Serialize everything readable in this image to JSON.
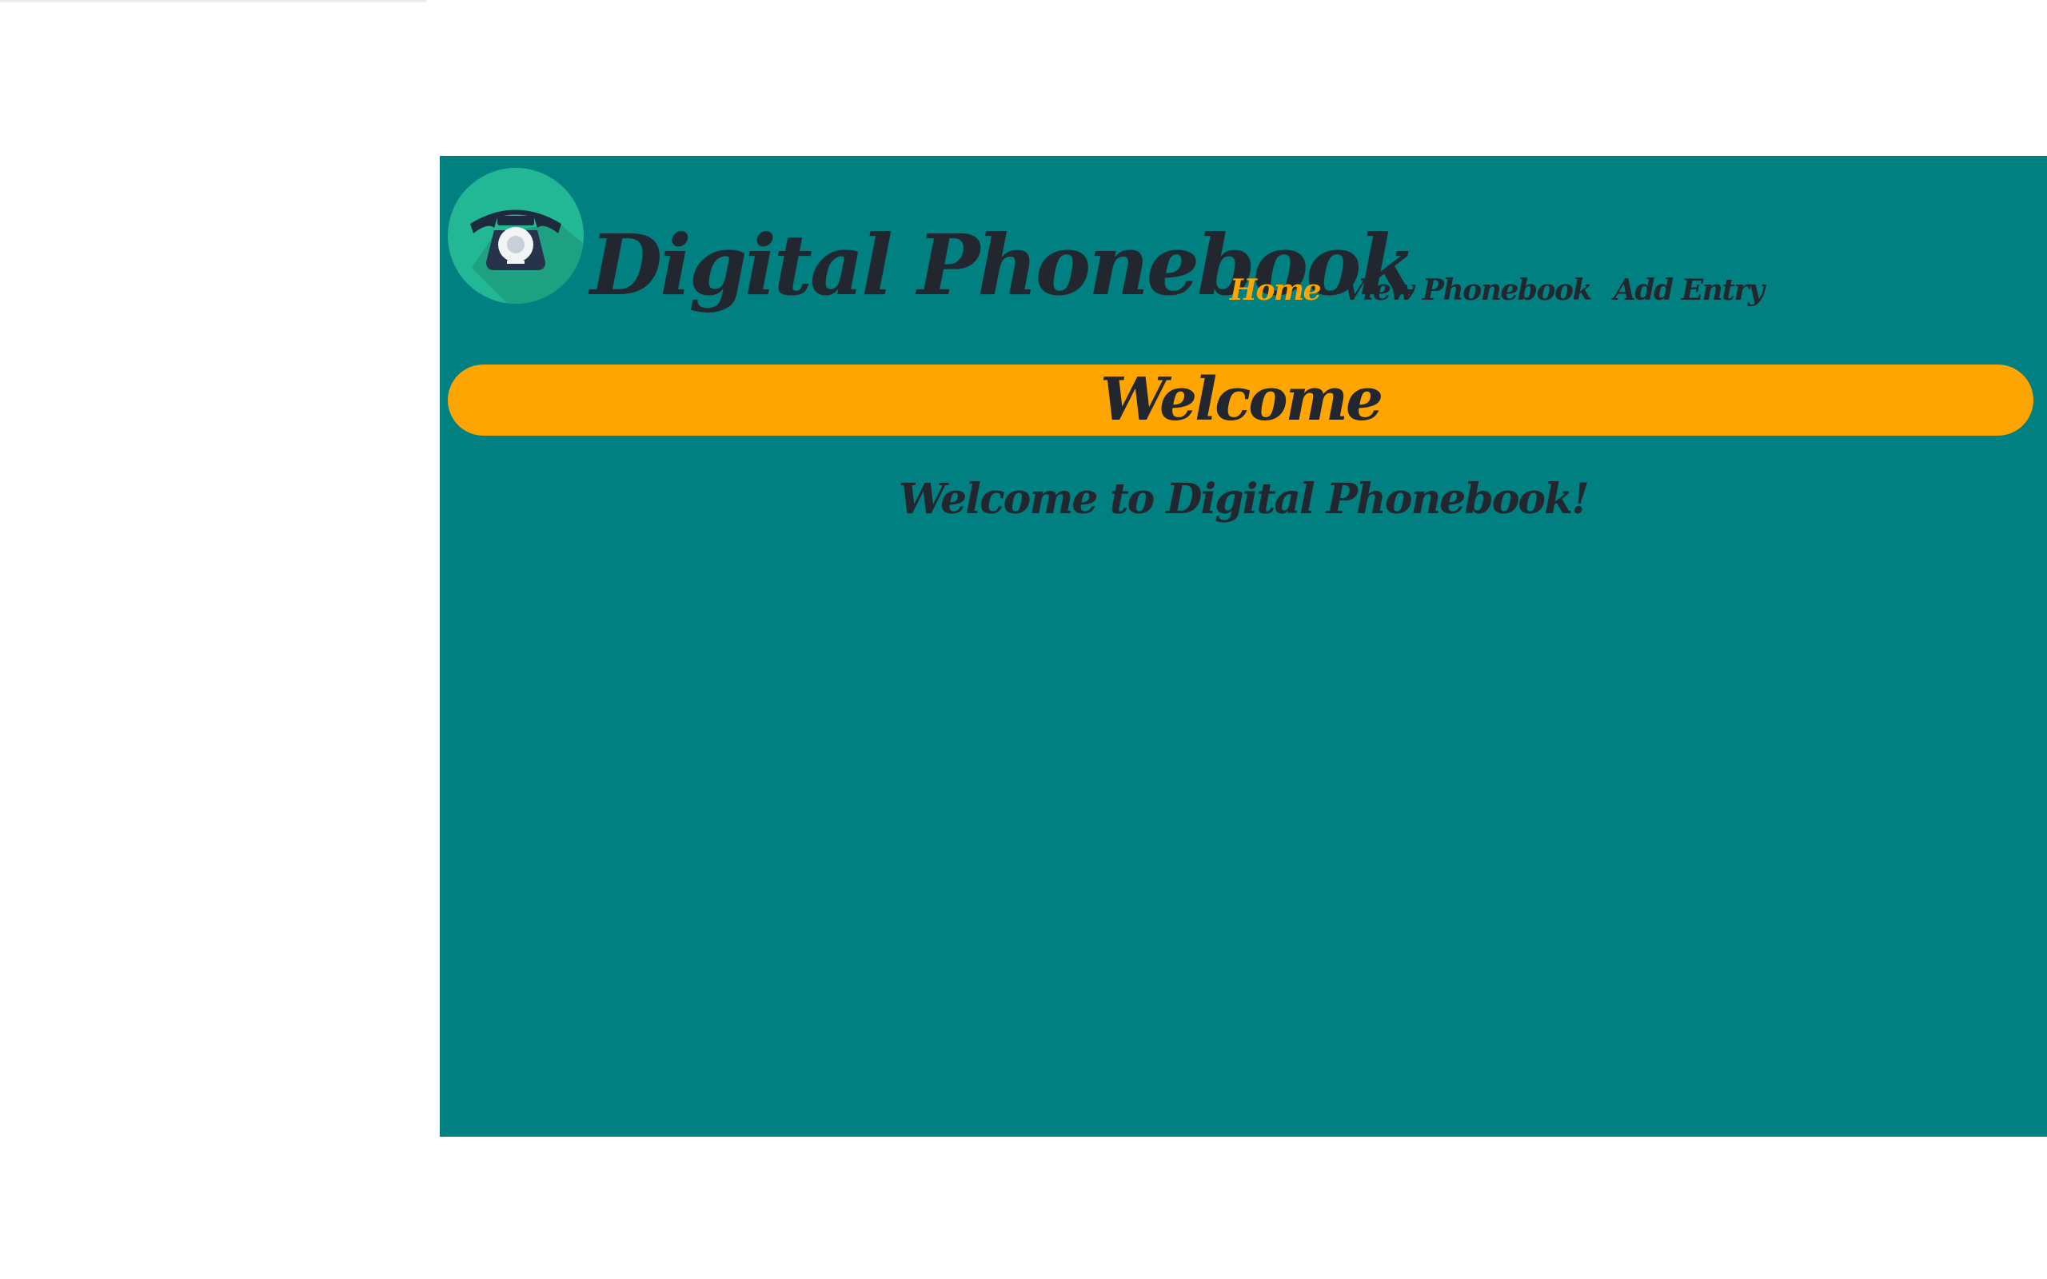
{
  "header": {
    "title": "Digital Phonebook",
    "logo_icon": "telephone-icon"
  },
  "nav": {
    "items": [
      {
        "label": "Home",
        "active": true
      },
      {
        "label": "View Phonebook",
        "active": false
      },
      {
        "label": "Add Entry",
        "active": false
      }
    ]
  },
  "banner": {
    "title": "Welcome"
  },
  "main": {
    "message": "Welcome to Digital Phonebook!"
  },
  "colors": {
    "background": "#008080",
    "accent": "#ffa500",
    "text": "#22262e",
    "logo_circle": "#22b896"
  }
}
